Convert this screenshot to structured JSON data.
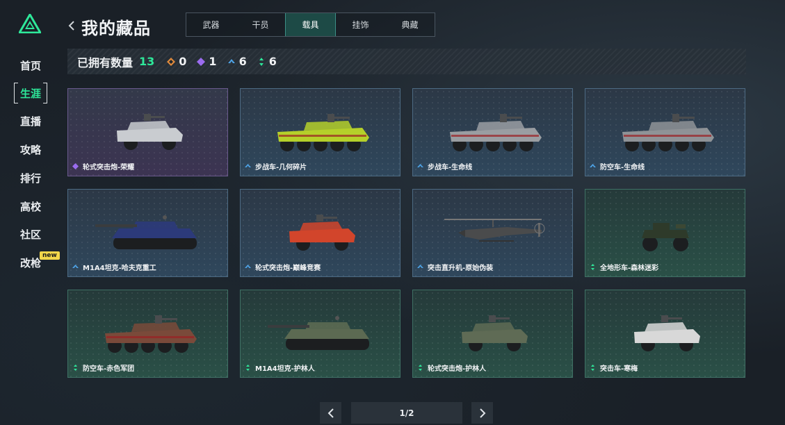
{
  "nav": {
    "items": [
      {
        "label": "首页"
      },
      {
        "label": "生涯"
      },
      {
        "label": "直播"
      },
      {
        "label": "攻略"
      },
      {
        "label": "排行"
      },
      {
        "label": "高校"
      },
      {
        "label": "社区"
      },
      {
        "label": "改枪"
      }
    ],
    "active_index": 1,
    "new_badge": "new"
  },
  "header": {
    "title": "我的藏品",
    "tabs": [
      {
        "label": "武器"
      },
      {
        "label": "干员"
      },
      {
        "label": "载具"
      },
      {
        "label": "挂饰"
      },
      {
        "label": "典藏"
      }
    ],
    "active_tab": 2
  },
  "stats": {
    "label": "已拥有数量",
    "total": "13",
    "rarities": [
      {
        "name": "orange",
        "count": "0",
        "color": "#e08a3c"
      },
      {
        "name": "purple",
        "count": "1",
        "color": "#9b6cf0"
      },
      {
        "name": "blue",
        "count": "6",
        "color": "#4ea3e6"
      },
      {
        "name": "green",
        "count": "6",
        "color": "#2ee89a"
      }
    ]
  },
  "items": [
    {
      "name": "轮式突击炮-荣耀",
      "rarity": "purple",
      "shape": "armored-car",
      "color": "#c9ccd0"
    },
    {
      "name": "步战车-几何碎片",
      "rarity": "blue",
      "shape": "ifv",
      "color": "#b5d02a"
    },
    {
      "name": "步战车-生命线",
      "rarity": "blue",
      "shape": "ifv",
      "color": "#9a9ea2"
    },
    {
      "name": "防空车-生命线",
      "rarity": "blue",
      "shape": "ifv",
      "color": "#8f9397"
    },
    {
      "name": "M1A4坦克-哈夫克重工",
      "rarity": "blue",
      "shape": "tank",
      "color": "#2c3a7a"
    },
    {
      "name": "轮式突击炮-巅峰竞赛",
      "rarity": "blue",
      "shape": "armored-car",
      "color": "#d2452b"
    },
    {
      "name": "突击直升机-原始伪装",
      "rarity": "blue",
      "shape": "helicopter",
      "color": "#4a4b4c"
    },
    {
      "name": "全地形车-森林迷彩",
      "rarity": "green",
      "shape": "atv",
      "color": "#2e3a2a"
    },
    {
      "name": "防空车-赤色军团",
      "rarity": "green",
      "shape": "ifv",
      "color": "#7a4a3a"
    },
    {
      "name": "M1A4坦克-护林人",
      "rarity": "green",
      "shape": "tank",
      "color": "#5c6a52"
    },
    {
      "name": "轮式突击炮-护林人",
      "rarity": "green",
      "shape": "armored-car",
      "color": "#5f6b55"
    },
    {
      "name": "突击车-寒梅",
      "rarity": "green",
      "shape": "armored-car",
      "color": "#d8d8d8"
    }
  ],
  "pagination": {
    "text": "1/2"
  },
  "icons": {
    "logo": "logo-icon",
    "back": "chevron-left-icon",
    "prev": "chevron-left-icon",
    "next": "chevron-right-icon"
  }
}
